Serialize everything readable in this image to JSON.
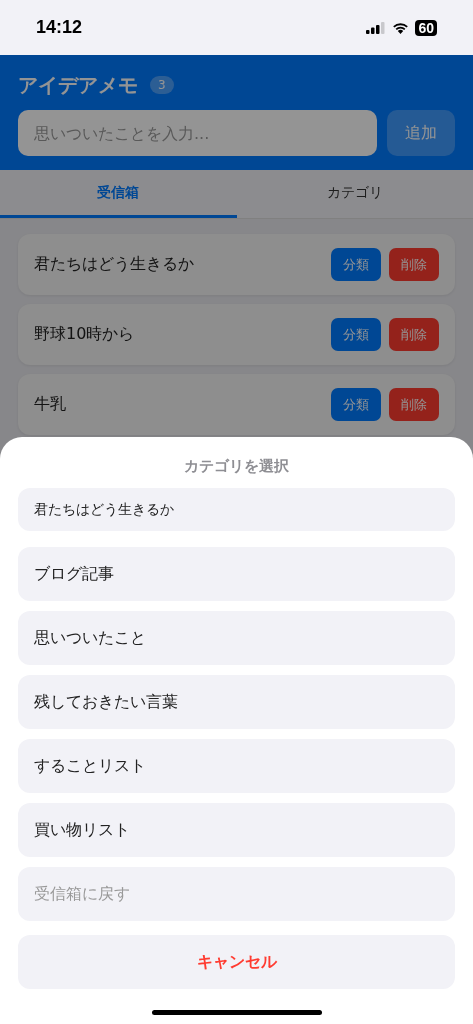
{
  "status_bar": {
    "time": "14:12",
    "battery": "60"
  },
  "header": {
    "title": "アイデアメモ",
    "count": "3",
    "input": {
      "placeholder": "思いついたことを入力..."
    },
    "add_button": "追加"
  },
  "tabs": [
    {
      "label": "受信箱",
      "selected": true
    },
    {
      "label": "カテゴリ",
      "selected": false
    }
  ],
  "memos": [
    {
      "text": "君たちはどう生きるか",
      "classify_button": "分類",
      "delete_button": "削除"
    },
    {
      "text": "野球10時から",
      "classify_button": "分類",
      "delete_button": "削除"
    },
    {
      "text": "牛乳",
      "classify_button": "分類",
      "delete_button": "削除"
    }
  ],
  "sheet": {
    "title": "カテゴリを選択",
    "options": [
      {
        "kind": "memo",
        "label": "君たちはどう生きるか"
      },
      {
        "kind": "category",
        "label": "ブログ記事"
      },
      {
        "kind": "category",
        "label": "思いついたこと"
      },
      {
        "kind": "category",
        "label": "残しておきたい言葉"
      },
      {
        "kind": "category",
        "label": "することリスト"
      },
      {
        "kind": "category",
        "label": "買い物リスト"
      },
      {
        "kind": "return",
        "label": "受信箱に戻す"
      },
      {
        "kind": "cancel",
        "label": "キャンセル"
      }
    ]
  }
}
